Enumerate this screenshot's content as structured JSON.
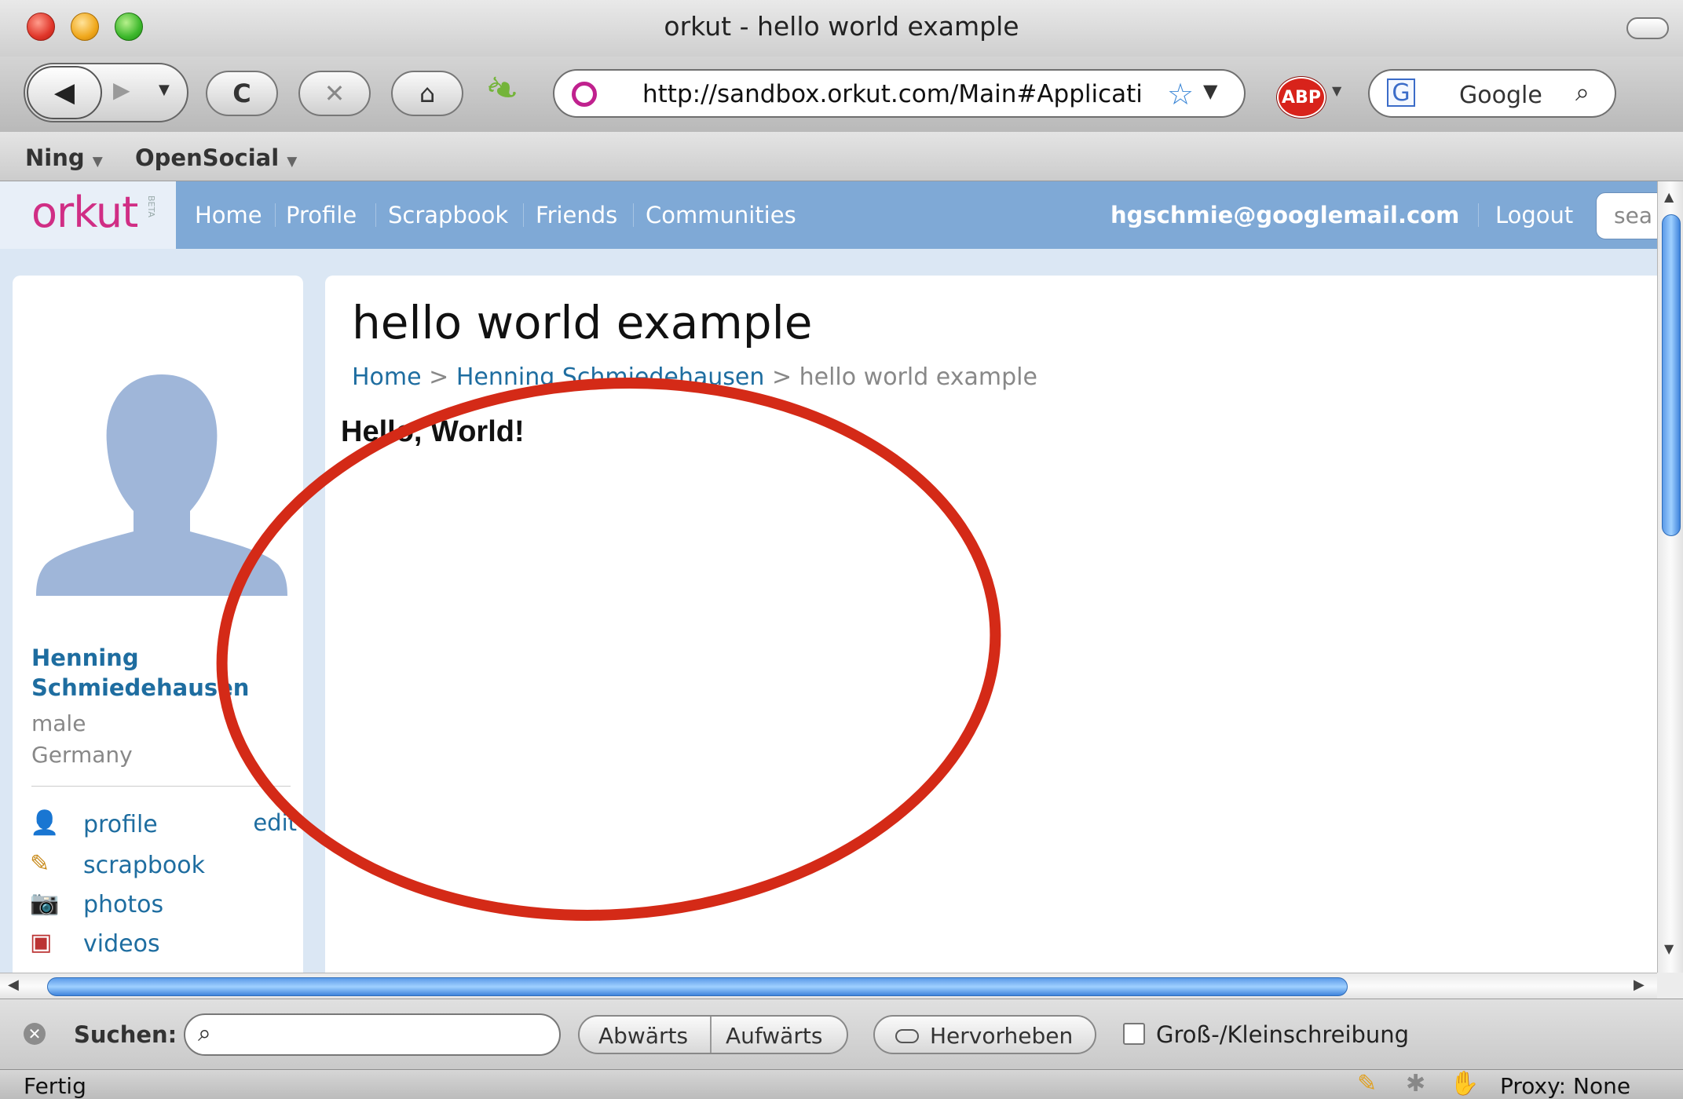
{
  "window": {
    "title": "orkut - hello world example"
  },
  "toolbar": {
    "back_glyph": "◀",
    "forward_glyph": "▶",
    "reload_glyph": "C",
    "stop_glyph": "✕",
    "home_glyph": "⌂",
    "url": "http://sandbox.orkut.com/Main#Applicati",
    "search_engine": "Google",
    "abp_label": "ABP"
  },
  "bookmarks": {
    "items": [
      {
        "label": "Ning"
      },
      {
        "label": "OpenSocial"
      }
    ]
  },
  "orkut": {
    "logo": "orkut",
    "beta": "BETA",
    "nav": [
      "Home",
      "Profile",
      "Scrapbook",
      "Friends",
      "Communities"
    ],
    "user_email": "hgschmie@googlemail.com",
    "logout": "Logout",
    "search_placeholder": "sea"
  },
  "profile": {
    "name": "Henning Schmiedehausen",
    "name_line1": "Henning",
    "name_line2": "Schmiedehausen",
    "gender": "male",
    "country": "Germany",
    "edit_label": "edit",
    "menu": [
      {
        "label": "profile",
        "icon": "user-icon"
      },
      {
        "label": "scrapbook",
        "icon": "scrapbook-icon"
      },
      {
        "label": "photos",
        "icon": "camera-icon"
      },
      {
        "label": "videos",
        "icon": "video-icon"
      }
    ]
  },
  "content": {
    "title": "hello world example",
    "breadcrumb": {
      "home": "Home",
      "user": "Henning Schmiedehausen",
      "current": "hello world example",
      "separator": ">"
    },
    "app_output": "Hello, World!"
  },
  "findbar": {
    "label": "Suchen:",
    "query": "",
    "prev": "Abwärts",
    "next": "Aufwärts",
    "highlight": "Hervorheben",
    "match_case": "Groß-/Kleinschreibung"
  },
  "statusbar": {
    "status": "Fertig",
    "proxy": "Proxy: None"
  },
  "colors": {
    "orkut_header": "#7fa9d6",
    "orkut_pink": "#d02e85",
    "link_blue": "#1e6da0",
    "annotation_red": "#d42a17"
  }
}
